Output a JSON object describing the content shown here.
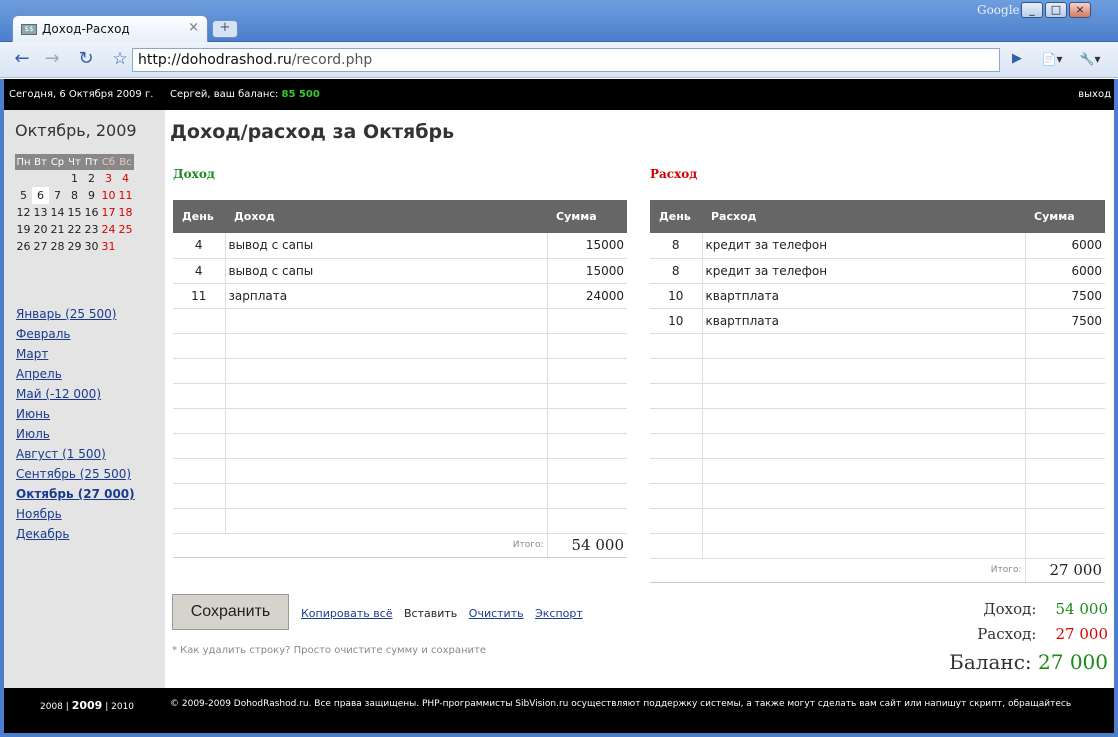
{
  "browser": {
    "tab_title": "Доход-Расход",
    "tab_close": "×",
    "new_tab": "+",
    "google": "Google",
    "window_buttons": [
      "_",
      "□",
      "×"
    ],
    "nav": {
      "back": "←",
      "forward": "→",
      "reload": "↻",
      "star": "☆",
      "go": "▶",
      "page": "📄▾",
      "wrench": "🔧▾"
    },
    "url_host": "http://dohodrashod.ru",
    "url_path": "/record.php"
  },
  "topbar": {
    "today": "Сегодня, 6 Октября 2009 г.",
    "greeting": "Сергей, ваш баланс:",
    "balance": "85 500",
    "logout": "выход"
  },
  "calendar": {
    "title": "Октябрь, 2009",
    "weekdays": [
      "Пн",
      "Вт",
      "Ср",
      "Чт",
      "Пт",
      "Сб",
      "Вс"
    ],
    "weeks": [
      [
        "",
        "",
        "",
        "1",
        "2",
        "3",
        "4"
      ],
      [
        "5",
        "6",
        "7",
        "8",
        "9",
        "10",
        "11"
      ],
      [
        "12",
        "13",
        "14",
        "15",
        "16",
        "17",
        "18"
      ],
      [
        "19",
        "20",
        "21",
        "22",
        "23",
        "24",
        "25"
      ],
      [
        "26",
        "27",
        "28",
        "29",
        "30",
        "31",
        ""
      ]
    ],
    "today": "6"
  },
  "months": [
    {
      "label": "Январь (25 500)",
      "current": false
    },
    {
      "label": "Февраль",
      "current": false
    },
    {
      "label": "Март",
      "current": false
    },
    {
      "label": "Апрель",
      "current": false
    },
    {
      "label": "Май (-12 000)",
      "current": false
    },
    {
      "label": "Июнь",
      "current": false
    },
    {
      "label": "Июль",
      "current": false
    },
    {
      "label": "Август (1 500)",
      "current": false
    },
    {
      "label": "Сентябрь (25 500)",
      "current": false
    },
    {
      "label": "Октябрь (27 000)",
      "current": true
    },
    {
      "label": "Ноябрь",
      "current": false
    },
    {
      "label": "Декабрь",
      "current": false
    }
  ],
  "main": {
    "title": "Доход/расход за Октябрь",
    "income": {
      "heading": "Доход",
      "color": "#1a8a1a",
      "columns": [
        "День",
        "Доход",
        "Сумма"
      ],
      "rows": [
        {
          "day": "4",
          "name": "вывод с сапы",
          "sum": "15000"
        },
        {
          "day": "4",
          "name": "вывод с сапы",
          "sum": "15000"
        },
        {
          "day": "11",
          "name": "зарплата",
          "sum": "24000"
        }
      ],
      "empty_rows": 9,
      "total_label": "Итого:",
      "total": "54 000"
    },
    "expense": {
      "heading": "Расход",
      "color": "#d00000",
      "columns": [
        "День",
        "Расход",
        "Сумма"
      ],
      "rows": [
        {
          "day": "8",
          "name": "кредит за телефон",
          "sum": "6000"
        },
        {
          "day": "8",
          "name": "кредит за телефон",
          "sum": "6000"
        },
        {
          "day": "10",
          "name": "квартплата",
          "sum": "7500"
        },
        {
          "day": "10",
          "name": "квартплата",
          "sum": "7500"
        }
      ],
      "empty_rows": 9,
      "total_label": "Итого:",
      "total": "27 000"
    },
    "save_label": "Сохранить",
    "actions": {
      "copy": "Копировать всё",
      "paste": "Вставить",
      "clear": "Очистить",
      "export": "Экспорт"
    },
    "hint": "* Как удалить строку? Просто очистите сумму и сохраните",
    "summary": {
      "income_label": "Доход:",
      "income": "54 000",
      "expense_label": "Расход:",
      "expense": "27 000",
      "balance_label": "Баланс:",
      "balance": "27 000"
    }
  },
  "footer": {
    "years": [
      "2008",
      "2009",
      "2010"
    ],
    "separator": "|",
    "copyright": "© 2009-2009 DohodRashod.ru. Все права защищены. PHP-программисты SibVision.ru осуществляют поддержку системы, а также могут сделать вам сайт или напишут скрипт, обращайтесь"
  }
}
